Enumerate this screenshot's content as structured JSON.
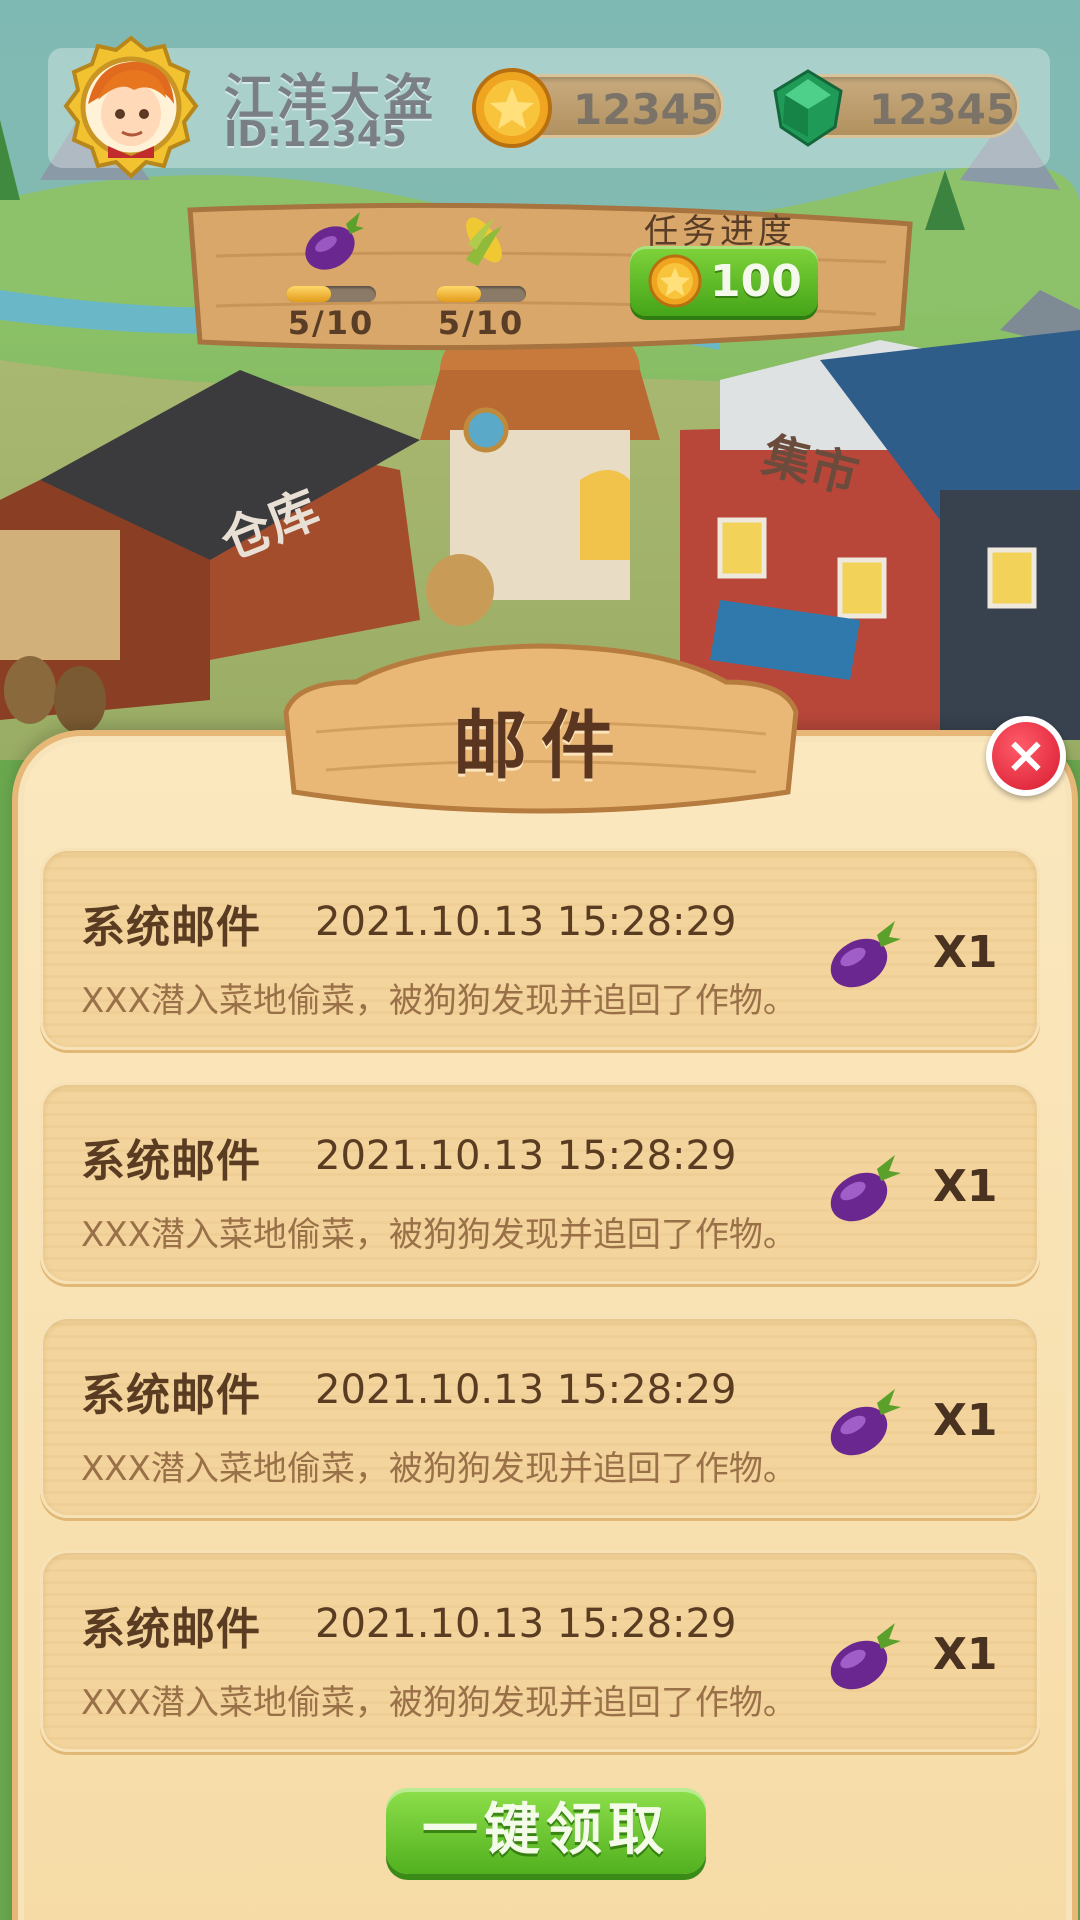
{
  "player": {
    "name": "江洋大盗",
    "id": "ID:12345",
    "coins": "12345",
    "gems": "12345"
  },
  "task_board": {
    "items": [
      {
        "icon": "eggplant-icon",
        "count": "5/10",
        "progress": 0.5
      },
      {
        "icon": "corn-icon",
        "count": "5/10",
        "progress": 0.5
      }
    ],
    "progress_label": "任务进度",
    "reward_value": "100"
  },
  "buildings": {
    "warehouse": "仓库",
    "market": "集市"
  },
  "mail": {
    "title": "邮件",
    "items": [
      {
        "sender": "系统邮件",
        "time": "2021.10.13  15:28:29",
        "desc": "XXX潜入菜地偷菜，被狗狗发现并追回了作物。",
        "reward_icon": "eggplant-icon",
        "qty": "X1"
      },
      {
        "sender": "系统邮件",
        "time": "2021.10.13  15:28:29",
        "desc": "XXX潜入菜地偷菜，被狗狗发现并追回了作物。",
        "reward_icon": "eggplant-icon",
        "qty": "X1"
      },
      {
        "sender": "系统邮件",
        "time": "2021.10.13  15:28:29",
        "desc": "XXX潜入菜地偷菜，被狗狗发现并追回了作物。",
        "reward_icon": "eggplant-icon",
        "qty": "X1"
      },
      {
        "sender": "系统邮件",
        "time": "2021.10.13  15:28:29",
        "desc": "XXX潜入菜地偷菜，被狗狗发现并追回了作物。",
        "reward_icon": "eggplant-icon",
        "qty": "X1"
      }
    ],
    "claim_all_label": "一键领取"
  },
  "colors": {
    "panel": "#f6dba6",
    "button_green": "#52b01f",
    "close_red": "#d71b2f"
  }
}
